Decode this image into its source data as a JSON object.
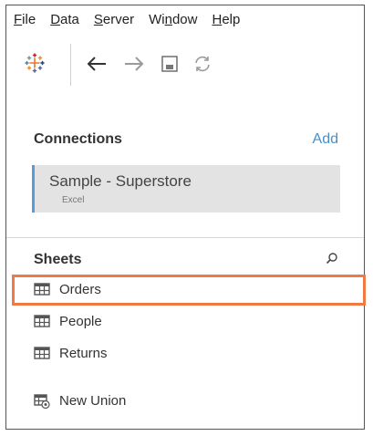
{
  "menubar": {
    "items": [
      {
        "label_pre": "",
        "label_u": "F",
        "label_post": "ile"
      },
      {
        "label_pre": "",
        "label_u": "D",
        "label_post": "ata"
      },
      {
        "label_pre": "",
        "label_u": "S",
        "label_post": "erver"
      },
      {
        "label_pre": "Wi",
        "label_u": "n",
        "label_post": "dow"
      },
      {
        "label_pre": "",
        "label_u": "H",
        "label_post": "elp"
      }
    ]
  },
  "toolbar": {
    "icons": [
      "tableau-logo-icon",
      "back-arrow-icon",
      "forward-arrow-icon",
      "save-icon",
      "refresh-icon"
    ]
  },
  "connections": {
    "title": "Connections",
    "add_label": "Add",
    "items": [
      {
        "name": "Sample - Superstore",
        "type": "Excel"
      }
    ]
  },
  "sheets": {
    "title": "Sheets",
    "search_icon": "search-icon",
    "items": [
      {
        "label": "Orders",
        "icon": "table-icon",
        "highlighted": true
      },
      {
        "label": "People",
        "icon": "table-icon"
      },
      {
        "label": "Returns",
        "icon": "table-icon"
      },
      {
        "label": "New Union",
        "icon": "union-icon"
      }
    ]
  },
  "colors": {
    "accent": "#4a8fc4",
    "highlight": "#f07a43",
    "connection_bar": "#5b9bd5"
  }
}
